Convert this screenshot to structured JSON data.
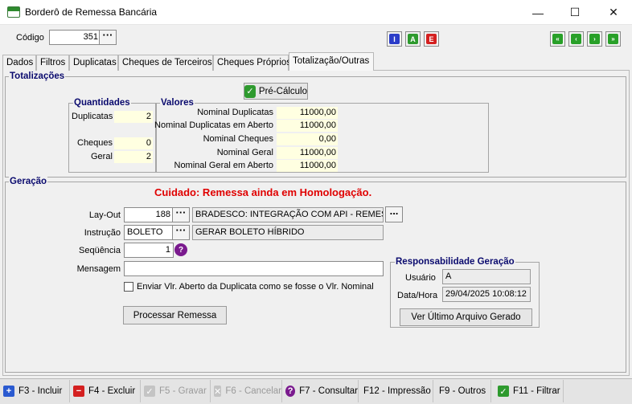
{
  "window": {
    "title": "Borderô de Remessa Bancária",
    "minimize": "—",
    "maximize": "☐",
    "close": "✕"
  },
  "header": {
    "code_label": "Código",
    "code_value": "351",
    "dots": "···",
    "info_letter": "I",
    "a_letter": "A",
    "e_letter": "E",
    "nav_first": "«",
    "nav_prev": "‹",
    "nav_next": "›",
    "nav_last": "»"
  },
  "tabs": [
    "Dados",
    "Filtros",
    "Duplicatas",
    "Cheques de Terceiros",
    "Cheques Próprios",
    "Totalização/Outras"
  ],
  "totalizacoes": {
    "title": "Totalizações",
    "precalc_label": "Pré-Cálculo",
    "quantidades_title": "Quantidades",
    "valores_title": "Valores",
    "quantidades": [
      {
        "label": "Duplicatas",
        "value": "2"
      },
      {
        "label": "Cheques",
        "value": "0"
      },
      {
        "label": "Geral",
        "value": "2"
      }
    ],
    "valores": [
      {
        "label": "Nominal Duplicatas",
        "value": "11000,00"
      },
      {
        "label": "Nominal Duplicatas em Aberto",
        "value": "11000,00"
      },
      {
        "label": "Nominal Cheques",
        "value": "0,00"
      },
      {
        "label": "Nominal Geral",
        "value": "11000,00"
      },
      {
        "label": "Nominal Geral em Aberto",
        "value": "11000,00"
      }
    ]
  },
  "geracao": {
    "title": "Geração",
    "warning": "Cuidado: Remessa ainda em Homologação.",
    "layout_label": "Lay-Out",
    "layout_value": "188",
    "layout_desc": "BRADESCO: INTEGRAÇÃO COM API - REMESSA",
    "more": "...",
    "instrucao_label": "Instrução",
    "instrucao_value": "BOLETO",
    "instrucao_desc": "GERAR BOLETO HÍBRIDO",
    "sequencia_label": "Seqüência",
    "sequencia_value": "1",
    "help": "?",
    "mensagem_label": "Mensagem",
    "mensagem_value": "",
    "checkbox_label": "Enviar Vlr. Aberto da Duplicata como se fosse o Vlr. Nominal",
    "processar_label": "Processar Remessa",
    "resp_title": "Responsabilidade Geração",
    "usuario_label": "Usuário",
    "usuario_value": "A",
    "datahora_label": "Data/Hora",
    "datahora_value": "29/04/2025 10:08:12",
    "ultimo_label": "Ver Último Arquivo Gerado"
  },
  "footer": {
    "buttons": [
      {
        "label": "F3 - Incluir",
        "icon": "plus"
      },
      {
        "label": "F4 - Excluir",
        "icon": "minus"
      },
      {
        "label": "F5 - Gravar",
        "icon": "check"
      },
      {
        "label": "F6 - Cancelar",
        "icon": "x"
      },
      {
        "label": "F7 - Consultar",
        "icon": "question"
      },
      {
        "label": "F12 - Impressão",
        "icon": ""
      },
      {
        "label": "F9 - Outros",
        "icon": ""
      },
      {
        "label": "F11 - Filtrar",
        "icon": "check"
      }
    ]
  },
  "colors": {
    "warning": "#e00000",
    "group_title": "#0a0a6e",
    "highlight": "#ffffe1",
    "nav_green": "#28a028",
    "info_blue": "#2a3cc8",
    "a_green": "#2e9a2e",
    "e_red": "#d42020"
  }
}
